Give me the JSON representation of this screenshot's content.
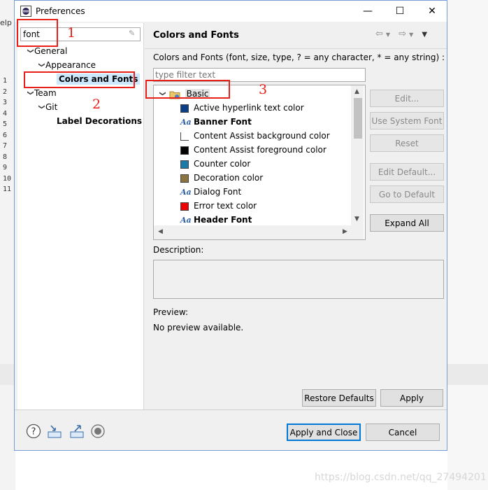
{
  "background": {
    "menu_fragment": "elp",
    "line_numbers": [
      "1",
      "2",
      "3",
      "4",
      "5",
      "6",
      "7",
      "8",
      "9",
      "10",
      "11"
    ]
  },
  "window": {
    "title": "Preferences",
    "minimize": "—",
    "maximize": "☐",
    "close": "✕"
  },
  "left": {
    "filter_value": "font",
    "tree": [
      {
        "label": "General",
        "level": 0,
        "expanded": true,
        "bold": false,
        "selected": false
      },
      {
        "label": "Appearance",
        "level": 1,
        "expanded": true,
        "bold": false,
        "selected": false
      },
      {
        "label": "Colors and Fonts",
        "level": 2,
        "expanded": false,
        "bold": true,
        "selected": true
      },
      {
        "label": "Team",
        "level": 0,
        "expanded": true,
        "bold": false,
        "selected": false
      },
      {
        "label": "Git",
        "level": 1,
        "expanded": true,
        "bold": false,
        "selected": false
      },
      {
        "label": "Label Decorations",
        "level": 2,
        "expanded": false,
        "bold": true,
        "selected": false
      }
    ]
  },
  "right": {
    "title": "Colors and Fonts",
    "description": "Colors and Fonts (font, size, type, ? = any character, * = any string) :",
    "type_filter_placeholder": "type filter text",
    "category": "Basic",
    "items": [
      {
        "label": "Active hyperlink text color",
        "kind": "color",
        "color": "#0a3f88",
        "bold": false
      },
      {
        "label": "Banner Font",
        "kind": "font",
        "bold": true
      },
      {
        "label": "Content Assist background color",
        "kind": "color",
        "color": "#ffffff",
        "bold": false
      },
      {
        "label": "Content Assist foreground color",
        "kind": "color",
        "color": "#000000",
        "bold": false
      },
      {
        "label": "Counter color",
        "kind": "color",
        "color": "#1a7aa8",
        "bold": false
      },
      {
        "label": "Decoration color",
        "kind": "color",
        "color": "#8c7440",
        "bold": false
      },
      {
        "label": "Dialog Font",
        "kind": "font",
        "bold": false
      },
      {
        "label": "Error text color",
        "kind": "color",
        "color": "#ee0000",
        "bold": false
      },
      {
        "label": "Header Font",
        "kind": "font",
        "bold": true
      }
    ],
    "buttons": {
      "edit": "Edit...",
      "use_system_font": "Use System Font",
      "reset": "Reset",
      "edit_default": "Edit Default...",
      "go_to_default": "Go to Default",
      "expand_all": "Expand All"
    },
    "description_label": "Description:",
    "preview_label": "Preview:",
    "preview_text": "No preview available.",
    "restore_defaults": "Restore Defaults",
    "apply": "Apply"
  },
  "footer": {
    "apply_and_close": "Apply and Close",
    "cancel": "Cancel"
  },
  "annotations": [
    "1",
    "2",
    "3"
  ],
  "watermark": "https://blog.csdn.net/qq_27494201",
  "colors": {
    "annotation_red": "#e8201a",
    "accent_blue": "#0078d7",
    "selection": "#cce8ff"
  }
}
